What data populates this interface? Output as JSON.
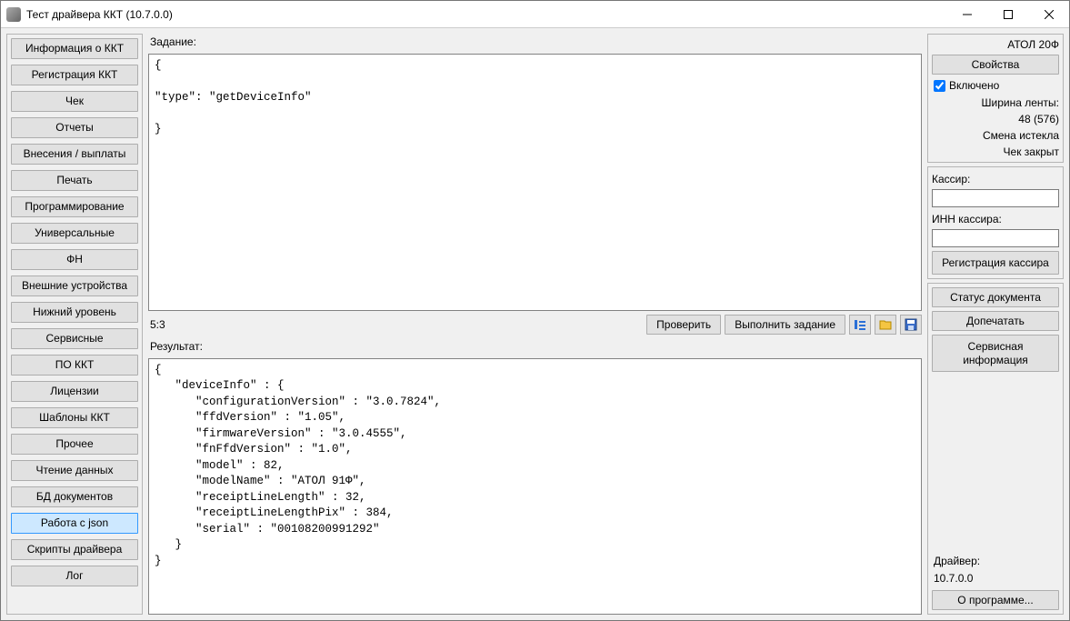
{
  "window": {
    "title": "Тест драйвера ККТ (10.7.0.0)"
  },
  "sidebar": {
    "items": [
      {
        "label": "Информация о ККТ"
      },
      {
        "label": "Регистрация ККТ"
      },
      {
        "label": "Чек"
      },
      {
        "label": "Отчеты"
      },
      {
        "label": "Внесения / выплаты"
      },
      {
        "label": "Печать"
      },
      {
        "label": "Программирование"
      },
      {
        "label": "Универсальные счетчики"
      },
      {
        "label": "ФН"
      },
      {
        "label": "Внешние устройства"
      },
      {
        "label": "Нижний уровень"
      },
      {
        "label": "Сервисные"
      },
      {
        "label": "ПО ККТ"
      },
      {
        "label": "Лицензии"
      },
      {
        "label": "Шаблоны ККТ"
      },
      {
        "label": "Прочее"
      },
      {
        "label": "Чтение данных"
      },
      {
        "label": "БД документов"
      },
      {
        "label": "Работа с json",
        "active": true
      },
      {
        "label": "Скрипты драйвера"
      },
      {
        "label": "Лог"
      }
    ]
  },
  "main": {
    "task_heading": "Задание:",
    "task_text": "{\n\n\"type\": \"getDeviceInfo\"\n\n}",
    "cursor_pos": "5:3",
    "check_btn": "Проверить",
    "run_btn": "Выполнить задание",
    "result_heading": "Результат:",
    "result_text": "{\n   \"deviceInfo\" : {\n      \"configurationVersion\" : \"3.0.7824\",\n      \"ffdVersion\" : \"1.05\",\n      \"firmwareVersion\" : \"3.0.4555\",\n      \"fnFfdVersion\" : \"1.0\",\n      \"model\" : 82,\n      \"modelName\" : \"АТОЛ 91Ф\",\n      \"receiptLineLength\" : 32,\n      \"receiptLineLengthPix\" : 384,\n      \"serial\" : \"00108200991292\"\n   }\n}"
  },
  "right": {
    "device_model": "АТОЛ 20Ф",
    "properties_btn": "Свойства",
    "enabled_text": "Включено",
    "enabled_checked": true,
    "tape_width_label": "Ширина ленты:",
    "tape_width_value": "48 (576)",
    "shift_expired": "Смена истекла",
    "receipt_closed": "Чек закрыт",
    "cashier_label": "Кассир:",
    "cashier_value": "",
    "cashier_inn_label": "ИНН кассира:",
    "cashier_inn_value": "",
    "cashier_reg_btn": "Регистрация кассира",
    "doc_status_btn": "Статус документа",
    "reprint_btn": "Допечатать",
    "service_info_btn": "Сервисная информация",
    "driver_label": "Драйвер:",
    "driver_version": "10.7.0.0",
    "about_btn": "О программе..."
  }
}
